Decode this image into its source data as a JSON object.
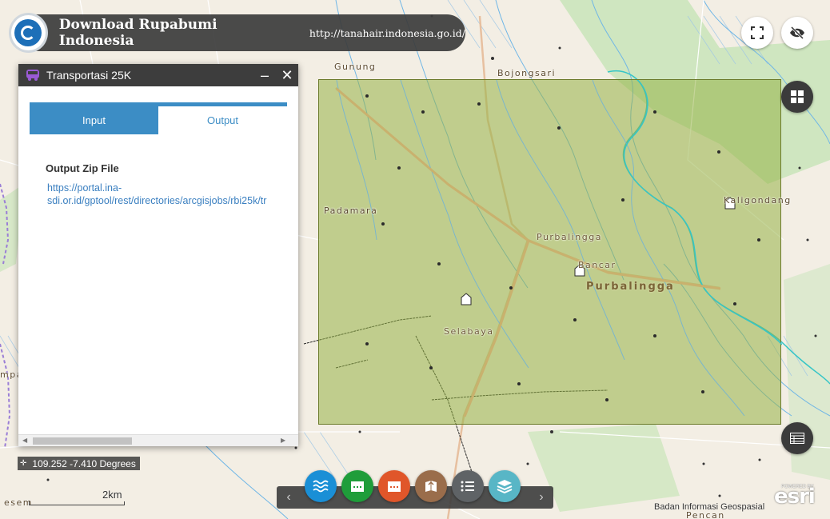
{
  "header": {
    "title": "Download Rupabumi Indonesia",
    "url": "http://tanahair.indonesia.go.id/"
  },
  "panel": {
    "title": "Transportasi 25K",
    "tabs": [
      {
        "label": "Input",
        "active": true
      },
      {
        "label": "Output",
        "active": false
      }
    ],
    "output_label": "Output Zip File",
    "output_link_line1": "https://portal.ina-",
    "output_link_line2": "sdi.or.id/gptool/rest/directories/arcgisjobs/rbi25k/tr"
  },
  "map": {
    "labels": {
      "gunung": "Gunung",
      "bojongsari": "Bojongsari",
      "kaligondang": "Kaligondang",
      "padamara": "Padamara",
      "purbalingga_town": "Purbalingga",
      "bancar": "Bancar",
      "purbalingga_region": "Purbalingga",
      "selabaya": "Selabaya",
      "sesem": "esem",
      "pencan": "Pencan",
      "mpa": "mpa"
    },
    "coordinates": "109.252 -7.410 Degrees",
    "scale": "2km",
    "attribution": "Badan Informasi Geospasial",
    "powered_by": "POWERED BY",
    "esri": "esri",
    "aoi_color": "#96b246"
  },
  "toolbar": {
    "prev": "‹",
    "next": "›",
    "tools": [
      {
        "icon": "waves-icon",
        "color": "#1a8fd6"
      },
      {
        "icon": "building-icon",
        "color": "#1f9d3a"
      },
      {
        "icon": "building-icon",
        "color": "#e0562a"
      },
      {
        "icon": "map-book-icon",
        "color": "#9a6d4b"
      },
      {
        "icon": "list-icon",
        "color": "#5f6366"
      },
      {
        "icon": "layers-icon",
        "color": "#58b6c6"
      }
    ]
  }
}
